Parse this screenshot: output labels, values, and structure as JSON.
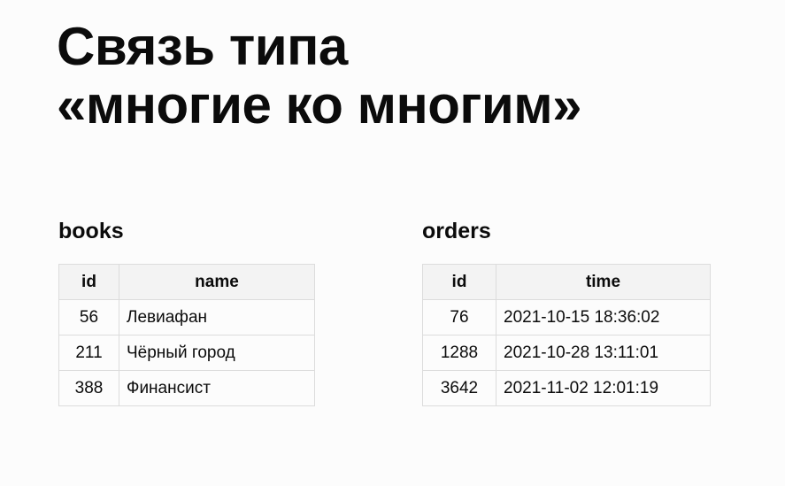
{
  "title": {
    "line1": "Связь типа",
    "line2": "«многие ко многим»"
  },
  "books": {
    "caption": "books",
    "headers": [
      "id",
      "name"
    ],
    "rows": [
      [
        "56",
        "Левиафан"
      ],
      [
        "211",
        "Чёрный город"
      ],
      [
        "388",
        "Финансист"
      ]
    ]
  },
  "orders": {
    "caption": "orders",
    "headers": [
      "id",
      "time"
    ],
    "rows": [
      [
        "76",
        "2021-10-15 18:36:02"
      ],
      [
        "1288",
        "2021-10-28 13:11:01"
      ],
      [
        "3642",
        "2021-11-02 12:01:19"
      ]
    ]
  }
}
